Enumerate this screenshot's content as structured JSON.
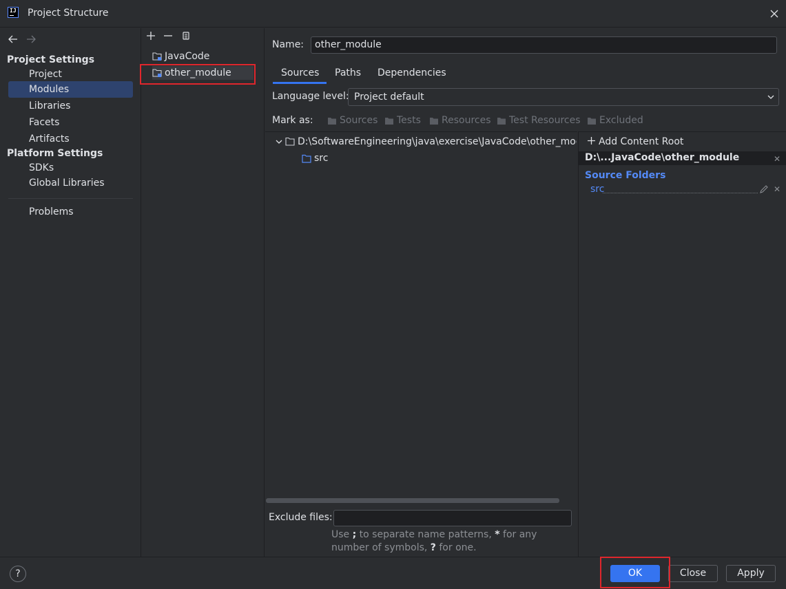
{
  "window": {
    "title": "Project Structure",
    "logo_text": "IJ"
  },
  "sidebar": {
    "project_settings_header": "Project Settings",
    "platform_settings_header": "Platform Settings",
    "items": [
      {
        "label": "Project",
        "selected": false
      },
      {
        "label": "Modules",
        "selected": true
      },
      {
        "label": "Libraries",
        "selected": false
      },
      {
        "label": "Facets",
        "selected": false
      },
      {
        "label": "Artifacts",
        "selected": false
      }
    ],
    "platform_items": [
      {
        "label": "SDKs"
      },
      {
        "label": "Global Libraries"
      }
    ],
    "problems_label": "Problems"
  },
  "modules": {
    "items": [
      {
        "label": "JavaCode",
        "selected": false
      },
      {
        "label": "other_module",
        "selected": true
      }
    ]
  },
  "module_settings": {
    "name_label": "Name:",
    "name_value": "other_module",
    "tabs": [
      {
        "label": "Sources",
        "active": true
      },
      {
        "label": "Paths",
        "active": false
      },
      {
        "label": "Dependencies",
        "active": false
      }
    ],
    "language_level_label": "Language level:",
    "language_level_value": "Project default",
    "mark_as_label": "Mark as:",
    "mark_as_buttons": [
      "Sources",
      "Tests",
      "Resources",
      "Test Resources",
      "Excluded"
    ],
    "tree_root": "D:\\SoftwareEngineering\\java\\exercise\\JavaCode\\other_module",
    "tree_child": "src",
    "exclude_label": "Exclude files:",
    "exclude_value": "",
    "exclude_hint_1": "Use ",
    "exclude_hint_semicolon": ";",
    "exclude_hint_2": " to separate name patterns, ",
    "exclude_hint_star": "*",
    "exclude_hint_3": " for any number of symbols, ",
    "exclude_hint_q": "?",
    "exclude_hint_4": " for one."
  },
  "content_roots": {
    "add_label": "Add Content Root",
    "root_path": "D:\\...JavaCode\\other_module",
    "source_folders_label": "Source Folders",
    "source_entry": "src"
  },
  "footer": {
    "help": "?",
    "ok": "OK",
    "close": "Close",
    "apply": "Apply"
  },
  "colors": {
    "accent": "#3574f0",
    "selection": "#2e436e",
    "source_blue": "#548af7",
    "highlight_red": "#e0262c"
  }
}
